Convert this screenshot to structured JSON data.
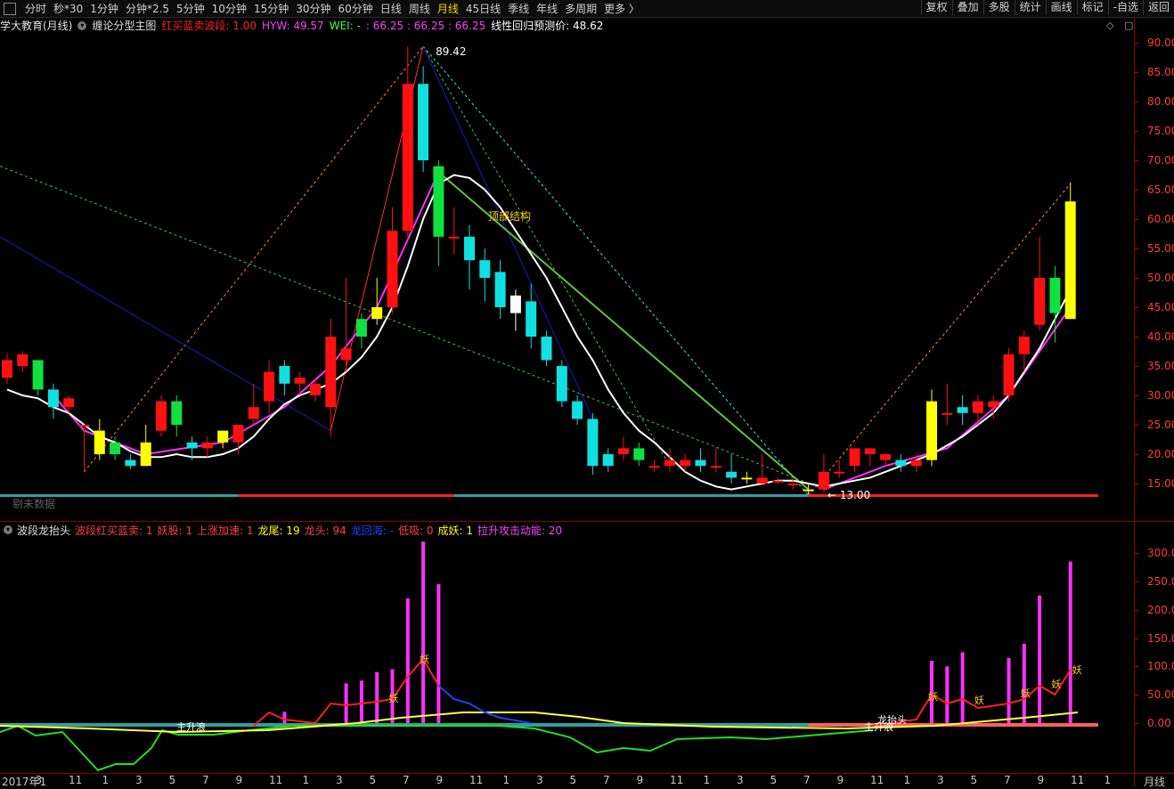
{
  "toolbar": {
    "timeframes": [
      "分时",
      "秒*30",
      "1分钟",
      "分钟*2.5",
      "5分钟",
      "10分钟",
      "15分钟",
      "30分钟",
      "60分钟",
      "日线",
      "周线",
      "月线",
      "45日线",
      "季线",
      "年线",
      "多周期",
      "更多 〉"
    ],
    "active": "月线",
    "right_buttons": [
      "复权",
      "叠加",
      "多股",
      "统计",
      "画线",
      "标记",
      "-自选",
      "返回"
    ]
  },
  "main_panel": {
    "title": "学大教育(月线)",
    "indicator": "缠论分型主图",
    "params": [
      {
        "label": "红买蓝卖波段:",
        "value": "1.00",
        "color": "#ff2020"
      },
      {
        "label": "HYW:",
        "value": "49.57",
        "color": "#ff40ff"
      },
      {
        "label": "WEI:",
        "value": "-",
        "color": "#40ff40"
      },
      {
        "label": ":",
        "value": "66.25 : 66.25 : 66.25",
        "color": "#ff40ff"
      },
      {
        "label": "线性回归预测价:",
        "value": "48.62",
        "color": "#ffffff"
      }
    ],
    "high_label": "89.42",
    "low_label": "13.00",
    "structure_label": "顶部结构",
    "watermark": "剔未数据",
    "y_ticks": [
      "90.00",
      "85.00",
      "80.00",
      "75.00",
      "70.00",
      "65.00",
      "60.00",
      "55.00",
      "50.00",
      "45.00",
      "40.00",
      "35.00",
      "30.00",
      "25.00",
      "20.00",
      "15.00"
    ]
  },
  "sub_panel": {
    "title": "波段龙抬头",
    "params": [
      {
        "label": "波段红买蓝卖:",
        "value": "1",
        "color": "#ff4040"
      },
      {
        "label": "妖股:",
        "value": "1",
        "color": "#ff4040"
      },
      {
        "label": "上涨加速:",
        "value": "1",
        "color": "#ff4040"
      },
      {
        "label": "龙尾:",
        "value": "19",
        "color": "#ffff00"
      },
      {
        "label": "龙头:",
        "value": "94",
        "color": "#ff4040"
      },
      {
        "label": "龙回海:",
        "value": "-",
        "color": "#2040ff"
      },
      {
        "label": "低吸:",
        "value": "0",
        "color": "#ff4040"
      },
      {
        "label": "成妖:",
        "value": "1",
        "color": "#ffff00"
      },
      {
        "label": "拉升攻击动能:",
        "value": "20",
        "color": "#ff40ff"
      }
    ],
    "y_ticks": [
      "300.00",
      "250.00",
      "200.00",
      "150.00",
      "100.00",
      "50.00",
      "0.00"
    ],
    "labels": [
      "主升浪",
      "龙抬头",
      "妖"
    ]
  },
  "x_axis": {
    "labels": [
      "2017年1",
      "3",
      "11",
      "1",
      "3",
      "5",
      "7",
      "9",
      "11",
      "1",
      "3",
      "5",
      "7",
      "9",
      "11",
      "1",
      "3",
      "5",
      "7",
      "9",
      "11",
      "1",
      "3",
      "5",
      "7",
      "9",
      "11",
      "1",
      "3",
      "5",
      "7",
      "9",
      "11",
      "1"
    ],
    "period": "月线"
  },
  "chart_data": {
    "type": "candlestick",
    "candles": [
      {
        "o": 33,
        "c": 36,
        "h": 37,
        "l": 32
      },
      {
        "o": 35,
        "c": 37,
        "h": 37.5,
        "l": 34
      },
      {
        "o": 36,
        "c": 31,
        "h": 36,
        "l": 30
      },
      {
        "o": 31,
        "c": 28,
        "h": 32,
        "l": 26
      },
      {
        "o": 28,
        "c": 29.5,
        "h": 30,
        "l": 27
      },
      {
        "o": 25,
        "c": 25,
        "h": 25,
        "l": 17
      },
      {
        "o": 24,
        "c": 20,
        "h": 26,
        "l": 19
      },
      {
        "o": 22,
        "c": 20,
        "h": 23,
        "l": 19
      },
      {
        "o": 19,
        "c": 18,
        "h": 20,
        "l": 17.5
      },
      {
        "o": 18,
        "c": 22,
        "h": 25,
        "l": 18
      },
      {
        "o": 24,
        "c": 29,
        "h": 30,
        "l": 23
      },
      {
        "o": 25,
        "c": 29,
        "h": 30,
        "l": 23
      },
      {
        "o": 22,
        "c": 21,
        "h": 23,
        "l": 19
      },
      {
        "o": 21,
        "c": 22,
        "h": 23,
        "l": 19.5
      },
      {
        "o": 22,
        "c": 24,
        "h": 24,
        "l": 21
      },
      {
        "o": 22,
        "c": 25,
        "h": 25,
        "l": 20
      },
      {
        "o": 26,
        "c": 28,
        "h": 32,
        "l": 25
      },
      {
        "o": 29,
        "c": 34,
        "h": 36,
        "l": 27
      },
      {
        "o": 35,
        "c": 32,
        "h": 36,
        "l": 30
      },
      {
        "o": 32,
        "c": 33,
        "h": 34,
        "l": 30
      },
      {
        "o": 30,
        "c": 32,
        "h": 33,
        "l": 29
      },
      {
        "o": 28,
        "c": 40,
        "h": 43,
        "l": 23
      },
      {
        "o": 36,
        "c": 38,
        "h": 50,
        "l": 34
      },
      {
        "o": 43,
        "c": 40,
        "h": 44,
        "l": 38
      },
      {
        "o": 43,
        "c": 45,
        "h": 50,
        "l": 42
      },
      {
        "o": 45,
        "c": 58,
        "h": 62,
        "l": 44
      },
      {
        "o": 58,
        "c": 83,
        "h": 89.4,
        "l": 57
      },
      {
        "o": 83,
        "c": 70,
        "h": 86,
        "l": 68
      },
      {
        "o": 69,
        "c": 57,
        "h": 70,
        "l": 52
      },
      {
        "o": 57,
        "c": 57,
        "h": 62,
        "l": 54
      },
      {
        "o": 57,
        "c": 53,
        "h": 59,
        "l": 48
      },
      {
        "o": 53,
        "c": 50,
        "h": 55,
        "l": 46
      },
      {
        "o": 51,
        "c": 45,
        "h": 53,
        "l": 43
      },
      {
        "o": 47,
        "c": 44,
        "h": 48,
        "l": 41
      },
      {
        "o": 46,
        "c": 40,
        "h": 49,
        "l": 38
      },
      {
        "o": 40,
        "c": 36,
        "h": 41,
        "l": 35
      },
      {
        "o": 35,
        "c": 29,
        "h": 36,
        "l": 28
      },
      {
        "o": 29,
        "c": 26,
        "h": 30,
        "l": 25
      },
      {
        "o": 26,
        "c": 18,
        "h": 27,
        "l": 16.5
      },
      {
        "o": 20,
        "c": 18,
        "h": 21,
        "l": 17
      },
      {
        "o": 20,
        "c": 21,
        "h": 23,
        "l": 19
      },
      {
        "o": 21,
        "c": 19,
        "h": 22,
        "l": 18
      },
      {
        "o": 18,
        "c": 18,
        "h": 19,
        "l": 17
      },
      {
        "o": 18,
        "c": 19,
        "h": 21,
        "l": 17
      },
      {
        "o": 18,
        "c": 19,
        "h": 20,
        "l": 17
      },
      {
        "o": 19,
        "c": 18,
        "h": 21,
        "l": 17
      },
      {
        "o": 18,
        "c": 18,
        "h": 21,
        "l": 17
      },
      {
        "o": 17,
        "c": 16,
        "h": 20,
        "l": 15
      },
      {
        "o": 16,
        "c": 16,
        "h": 17,
        "l": 15
      },
      {
        "o": 15,
        "c": 16,
        "h": 20,
        "l": 15
      },
      {
        "o": 15.5,
        "c": 15.5,
        "h": 16,
        "l": 15
      },
      {
        "o": 15,
        "c": 15,
        "h": 16,
        "l": 14
      },
      {
        "o": 14,
        "c": 14,
        "h": 15,
        "l": 13
      },
      {
        "o": 14,
        "c": 17,
        "h": 20,
        "l": 13.5
      },
      {
        "o": 17,
        "c": 17,
        "h": 19,
        "l": 16
      },
      {
        "o": 18,
        "c": 21,
        "h": 21,
        "l": 17
      },
      {
        "o": 20,
        "c": 21,
        "h": 21,
        "l": 18
      },
      {
        "o": 19,
        "c": 20,
        "h": 20,
        "l": 18
      },
      {
        "o": 19,
        "c": 18,
        "h": 20,
        "l": 17
      },
      {
        "o": 18,
        "c": 19,
        "h": 20,
        "l": 17
      },
      {
        "o": 19,
        "c": 29,
        "h": 31,
        "l": 18
      },
      {
        "o": 27,
        "c": 27,
        "h": 32,
        "l": 25
      },
      {
        "o": 28,
        "c": 27,
        "h": 30,
        "l": 25
      },
      {
        "o": 27,
        "c": 29,
        "h": 30,
        "l": 25
      },
      {
        "o": 28,
        "c": 29,
        "h": 30,
        "l": 26
      },
      {
        "o": 30,
        "c": 37,
        "h": 38,
        "l": 29
      },
      {
        "o": 37,
        "c": 40,
        "h": 41,
        "l": 34
      },
      {
        "o": 42,
        "c": 50,
        "h": 57,
        "l": 41
      },
      {
        "o": 50,
        "c": 44,
        "h": 52,
        "l": 39
      },
      {
        "o": 43,
        "c": 63,
        "h": 66.25,
        "l": 43
      }
    ],
    "sub_bars": [
      {
        "i": 18,
        "v": 20
      },
      {
        "i": 22,
        "v": 70
      },
      {
        "i": 23,
        "v": 75
      },
      {
        "i": 24,
        "v": 90
      },
      {
        "i": 25,
        "v": 95
      },
      {
        "i": 26,
        "v": 220
      },
      {
        "i": 27,
        "v": 320
      },
      {
        "i": 28,
        "v": 245
      },
      {
        "i": 60,
        "v": 110
      },
      {
        "i": 61,
        "v": 100
      },
      {
        "i": 62,
        "v": 125
      },
      {
        "i": 65,
        "v": 115
      },
      {
        "i": 66,
        "v": 140
      },
      {
        "i": 67,
        "v": 225
      },
      {
        "i": 69,
        "v": 285
      }
    ]
  }
}
